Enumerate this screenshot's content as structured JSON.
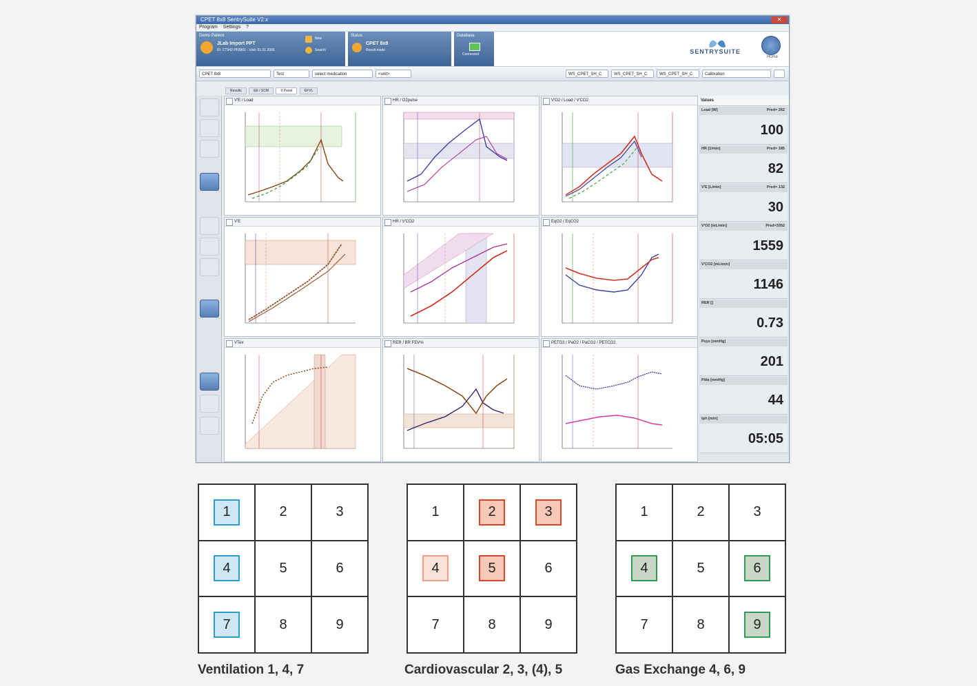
{
  "window": {
    "title": "CPET 8x8 SentrySuite V2.x",
    "menu": [
      "Program",
      "Settings",
      "?"
    ]
  },
  "patient": {
    "section_label": "Demo Patient",
    "name": "JLab Import PPT",
    "id_line": "ID: CT942-PF8901 - Visit: 01.01.2006",
    "new": "New",
    "search": "Search"
  },
  "status": {
    "section_label": "Status",
    "title": "CPET 8x8",
    "sub": "Result mode"
  },
  "database": {
    "section_label": "Database",
    "state": "Connected"
  },
  "brand": "SENTRYSUITE",
  "home_label": "Home",
  "toolbar": {
    "program": "CPET 8x8",
    "test": "Test",
    "medication": "select medication",
    "unit": "<unit>",
    "ws1": "WS_CPET_SH_C",
    "ws2": "WS_CPET_SH_C",
    "ws3": "WS_CPET_SH_C",
    "calibration": "Calibration"
  },
  "tabs": [
    "Results",
    "EE / SCM",
    "9 Panel",
    "EFVL"
  ],
  "panels": [
    "V'E / Load",
    "HR / O2pulse",
    "V'O2 / Load / V'CO2",
    "V'E",
    "HR / V'CO2",
    "EqO2 / EqCO2",
    "VTex",
    "RER / BR FEV%",
    "PETO2 / PaO2 / PaCO2 / PETCO2"
  ],
  "values_header": "Values",
  "values": [
    {
      "label": "Load [W]",
      "pred": "Pred= 262",
      "value": "100"
    },
    {
      "label": "HR [1/min]",
      "pred": "Pred= 185",
      "value": "82"
    },
    {
      "label": "V'E [L/min]",
      "pred": "Pred= 132",
      "value": "30"
    },
    {
      "label": "V'O2 [mL/min]",
      "pred": "Pred=3352",
      "value": "1559"
    },
    {
      "label": "V'CO2 [mL/min]",
      "pred": "",
      "value": "1146"
    },
    {
      "label": "RER []",
      "pred": "",
      "value": "0.73"
    },
    {
      "label": "Psys [mmHg]",
      "pred": "",
      "value": "201"
    },
    {
      "label": "Pdia [mmHg]",
      "pred": "",
      "value": "44"
    },
    {
      "label": "tph [min]",
      "pred": "",
      "value": "05:05"
    }
  ],
  "grids": [
    {
      "caption": "Ventilation  1, 4, 7",
      "cells": [
        "1",
        "2",
        "3",
        "4",
        "5",
        "6",
        "7",
        "8",
        "9"
      ]
    },
    {
      "caption": "Cardiovascular  2, 3, (4), 5",
      "cells": [
        "1",
        "2",
        "3",
        "4",
        "5",
        "6",
        "7",
        "8",
        "9"
      ]
    },
    {
      "caption": "Gas Exchange  4, 6, 9",
      "cells": [
        "1",
        "2",
        "3",
        "4",
        "5",
        "6",
        "7",
        "8",
        "9"
      ]
    }
  ],
  "colors": {
    "ventilation": "#cfe7f3",
    "ventilation_border": "#2b9fd3",
    "cardio": "#f6c9b6",
    "cardio_border": "#d9442a",
    "cardio_light": "#fbe3d9",
    "cardio_light_border": "#f0a089",
    "gas": "#c9d7c7",
    "gas_border": "#2f9b56"
  }
}
